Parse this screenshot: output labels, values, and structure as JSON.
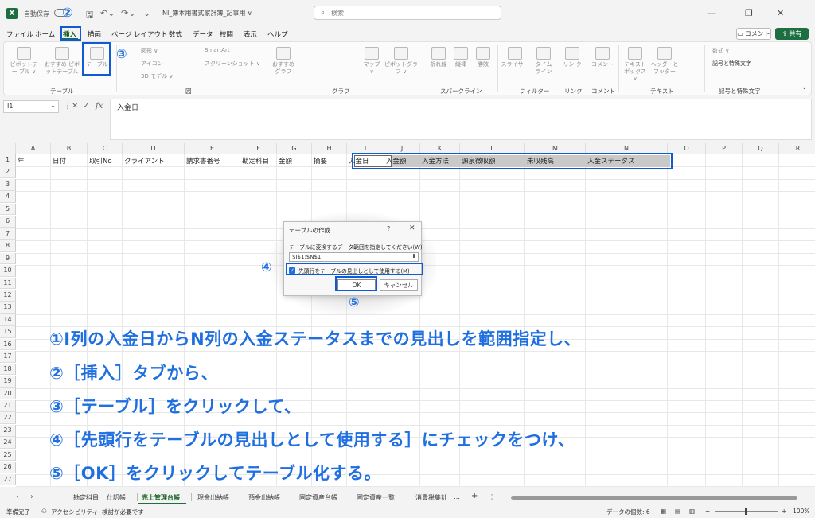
{
  "titlebar": {
    "logo": "X",
    "autosave_label": "自動保存",
    "toggle_state": "オフ",
    "doc_title": "NI_簿本用書式家計簿_記事用 ∨",
    "search_placeholder": "検索"
  },
  "menu": {
    "items": [
      "ファイル",
      "ホーム",
      "挿入",
      "描画",
      "ページ レイアウト",
      "数式",
      "データ",
      "校閲",
      "表示",
      "ヘルプ"
    ],
    "comment_label": "コメント",
    "share_label": "共有"
  },
  "ribbon": {
    "pivot": "ピボットテー ブル ∨",
    "recommended_pivot": "おすすめ ピボットテーブル",
    "table": "テーブル",
    "shapes": "図形 ∨",
    "icons": "アイコン",
    "model3d": "3D モデル ∨",
    "smartart": "SmartArt",
    "screenshot": "スクリーンショット ∨",
    "recommended_chart": "おすすめ グラフ",
    "map": "マップ ∨",
    "pivot_chart": "ピボットグラフ ∨",
    "line": "折れ線",
    "column": "縦棒",
    "winloss": "勝敗",
    "slicer": "スライサー",
    "timeline": "タイム ライン",
    "link": "リン ク",
    "comment": "コメント",
    "textbox": "テキスト ボックス ∨",
    "headerfooter": "ヘッダーと フッター",
    "equation": "数式 ∨",
    "symbol": "記号と特殊文字",
    "groups": [
      "テーブル",
      "図",
      "グラフ",
      "スパークライン",
      "フィルター",
      "リンク",
      "コメント",
      "テキスト",
      "記号と特殊文字"
    ]
  },
  "formula_bar": {
    "name_box": "I1",
    "cancel": "✕",
    "enter": "✓",
    "fx": "fx",
    "content": "入金日"
  },
  "columns": [
    "A",
    "B",
    "C",
    "D",
    "E",
    "F",
    "G",
    "H",
    "I",
    "J",
    "K",
    "L",
    "M",
    "N",
    "O",
    "P",
    "Q",
    "R"
  ],
  "rows": [
    "1",
    "2",
    "3",
    "4",
    "5",
    "6",
    "7",
    "8",
    "9",
    "10",
    "11",
    "12",
    "13",
    "14",
    "15",
    "16",
    "17",
    "18",
    "19",
    "20",
    "21",
    "22",
    "23",
    "24",
    "25",
    "26",
    "27"
  ],
  "row1": [
    "年",
    "日付",
    "取引No",
    "クライアント",
    "請求書番号",
    "勘定科目",
    "金額",
    "摘要",
    "入金日",
    "入金額",
    "入金方法",
    "源泉徴収額",
    "未収残高",
    "入金ステータス"
  ],
  "dialog": {
    "title": "テーブルの作成",
    "help": "?",
    "close": "✕",
    "prompt": "テーブルに変換するデータ範囲を指定してください(W)",
    "range": "$I$1:$N$1",
    "range_button": "⬆",
    "checkbox_checked": "✓",
    "checkbox_label": "先頭行をテーブルの見出しとして使用する(M)",
    "ok": "OK",
    "cancel": "キャンセル"
  },
  "annotations": {
    "n1": "①",
    "n2": "②",
    "n3": "③",
    "n4": "④",
    "n5": "⑤",
    "instructions": [
      "①I列の入金日からN列の入金ステータスまでの見出しを範囲指定し、",
      "②［挿入］タブから、",
      "③［テーブル］をクリックして、",
      "④［先頭行をテーブルの見出しとして使用する］にチェックをつけ、",
      "⑤［OK］をクリックしてテーブル化する。"
    ],
    "color": "#1f6fe0"
  },
  "sheets": {
    "tabs": [
      "勘定科目",
      "仕訳帳",
      "売上管理台帳",
      "現金出納帳",
      "預金出納帳",
      "固定資産台帳",
      "固定資産一覧",
      "消費税集計"
    ],
    "active": "売上管理台帳",
    "ellipsis": "…",
    "add": "+",
    "more": "⋮"
  },
  "status": {
    "ready": "準備完了",
    "accessibility": "アクセシビリティ: 検討が必要です",
    "count": "データの個数: 6",
    "zoom": "100%"
  }
}
